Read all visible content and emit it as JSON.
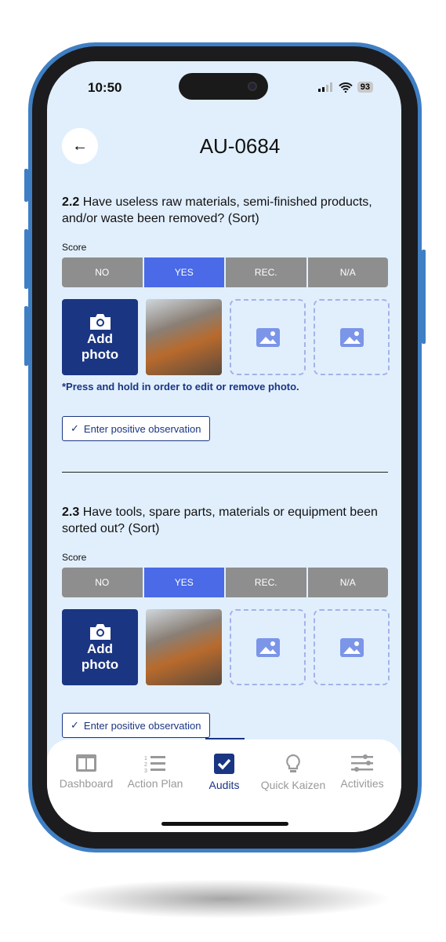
{
  "status": {
    "time": "10:50",
    "battery": "93"
  },
  "header": {
    "title": "AU-0684"
  },
  "questions": [
    {
      "number": "2.2",
      "text": " Have useless raw materials, semi-finished products, and/or waste been removed? (Sort)",
      "score_label": "Score",
      "options": [
        "NO",
        "YES",
        "REC.",
        "N/A"
      ],
      "selected": "YES",
      "add_photo": "Add photo",
      "hint": "*Press and hold in order to edit or remove photo.",
      "observation": "Enter positive observation"
    },
    {
      "number": "2.3",
      "text": " Have tools, spare parts, materials or equipment been sorted out? (Sort)",
      "score_label": "Score",
      "options": [
        "NO",
        "YES",
        "REC.",
        "N/A"
      ],
      "selected": "YES",
      "add_photo": "Add photo",
      "observation": "Enter positive observation"
    }
  ],
  "nav": [
    {
      "label": "Dashboard",
      "icon": "dashboard-icon"
    },
    {
      "label": "Action Plan",
      "icon": "numbered-list-icon"
    },
    {
      "label": "Audits",
      "icon": "checkbox-icon",
      "active": true
    },
    {
      "label": "Quick Kaizen",
      "icon": "lightbulb-icon"
    },
    {
      "label": "Activities",
      "icon": "sliders-icon"
    }
  ],
  "colors": {
    "accent": "#1a3582",
    "selected": "#4a6ae8",
    "unselected": "#8e8e8e",
    "background": "#e1effd"
  }
}
